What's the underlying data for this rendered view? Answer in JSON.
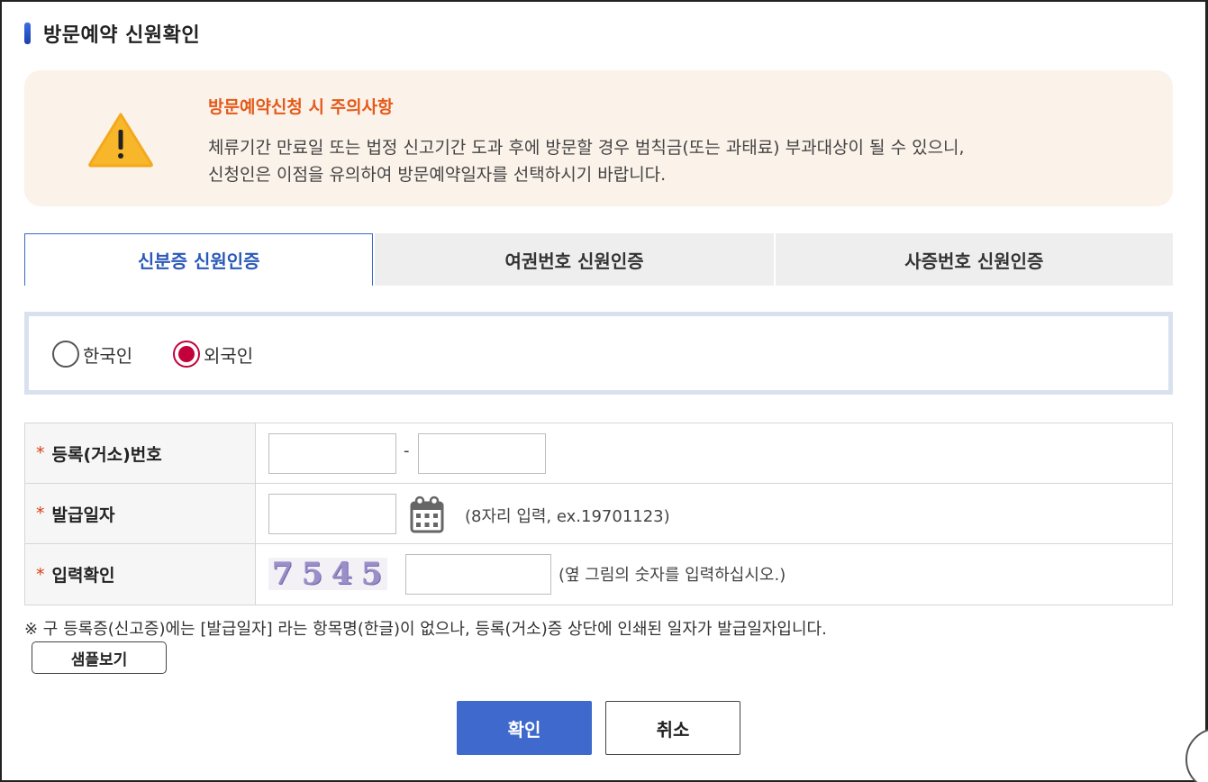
{
  "page": {
    "title": "방문예약 신원확인"
  },
  "notice": {
    "icon": "warning-triangle-icon",
    "title": "방문예약신청 시 주의사항",
    "line1": "체류기간 만료일 또는 법정 신고기간 도과 후에 방문할 경우 범칙금(또는 과태료) 부과대상이 될 수 있으니,",
    "line2": "신청인은 이점을 유의하여 방문예약일자를 선택하시기 바랍니다."
  },
  "tabs": [
    {
      "label": "신분증 신원인증",
      "active": true
    },
    {
      "label": "여권번호 신원인증",
      "active": false
    },
    {
      "label": "사증번호 신원인증",
      "active": false
    }
  ],
  "nationality": {
    "options": [
      {
        "label": "한국인",
        "checked": false
      },
      {
        "label": "외국인",
        "checked": true
      }
    ]
  },
  "form": {
    "required_mark": "*",
    "reg_no": {
      "label": "등록(거소)번호",
      "part1": "",
      "part2": "",
      "separator": "-"
    },
    "issue_date": {
      "label": "발급일자",
      "value": "",
      "hint": "(8자리 입력, ex.19701123)",
      "icon": "calendar-icon"
    },
    "captcha": {
      "label": "입력확인",
      "digits": [
        "7",
        "5",
        "4",
        "5"
      ],
      "value": "",
      "hint": "(옆 그림의 숫자를 입력하십시오.)"
    }
  },
  "note": "※ 구 등록증(신고증)에는 [발급일자] 라는 항목명(한글)이 없으나, 등록(거소)증 상단에 인쇄된 일자가 발급일자입니다.",
  "buttons": {
    "sample": "샘플보기",
    "confirm": "확인",
    "cancel": "취소"
  },
  "colors": {
    "accent": "#3f69cc",
    "notice_bg": "#fbf2ea",
    "notice_title": "#e35a1a",
    "radio_checked": "#c4003b"
  }
}
